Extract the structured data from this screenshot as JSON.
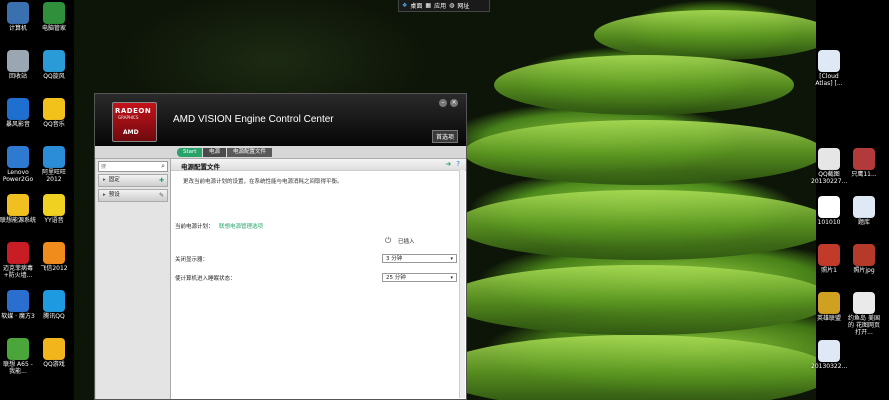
{
  "taskbar": {
    "items": [
      "桌面",
      "应用",
      "网址"
    ]
  },
  "desktop_left": [
    {
      "label": "计算机",
      "icon": "computer-icon",
      "color": "#3a6fb0"
    },
    {
      "label": "电脑管家",
      "icon": "shield-icon",
      "color": "#2f8f3a"
    },
    {
      "label": "回收站",
      "icon": "recycle-bin-icon",
      "color": "#9aa7b3"
    },
    {
      "label": "QQ旋风",
      "icon": "qq-whirlwind-icon",
      "color": "#2a9bd6"
    },
    {
      "label": "暴风影音",
      "icon": "storm-player-icon",
      "color": "#1f6fd1"
    },
    {
      "label": "QQ音乐",
      "icon": "qq-music-icon",
      "color": "#f2c21b"
    },
    {
      "label": "Lenovo Power2Go",
      "icon": "power2go-icon",
      "color": "#2f7ad1"
    },
    {
      "label": "阿里旺旺 2012",
      "icon": "aliwangwang-icon",
      "color": "#2b8cd8"
    },
    {
      "label": "联想能源系统",
      "icon": "lenovo-energy-icon",
      "color": "#f0c020"
    },
    {
      "label": "YY语音",
      "icon": "yy-voice-icon",
      "color": "#f0d020"
    },
    {
      "label": "迈克菲病毒 +防火墙...",
      "icon": "mcafee-icon",
      "color": "#c81d25"
    },
    {
      "label": "飞信2012",
      "icon": "fetion-icon",
      "color": "#f08c1c"
    },
    {
      "label": "软媒 · 魔方3",
      "icon": "rubik-cube-icon",
      "color": "#2a6fd0"
    },
    {
      "label": "腾讯QQ",
      "icon": "tencent-qq-icon",
      "color": "#1e9be0"
    },
    {
      "label": "联想 A65 - 我能...",
      "icon": "lenovo-phone-icon",
      "color": "#4aa63a"
    },
    {
      "label": "QQ游戏",
      "icon": "qq-game-icon",
      "color": "#f2b51c"
    }
  ],
  "desktop_right": [
    {
      "label": "[Cloud Atlas] [...",
      "icon": "document-icon",
      "color": "#dfe8f5"
    },
    {
      "label": "QQ截图 20130227...",
      "icon": "image-file-icon",
      "color": "#e6e6e6"
    },
    {
      "label": "只鹰11...",
      "icon": "person-photo-icon",
      "color": "#b33a3a"
    },
    {
      "label": "101010",
      "icon": "text-file-icon",
      "color": "#ffffff"
    },
    {
      "label": "题库",
      "icon": "folder-file-icon",
      "color": "#dfe8f5"
    },
    {
      "label": "照片1",
      "icon": "photo1-icon",
      "color": "#c23a2a"
    },
    {
      "label": "照片jpg",
      "icon": "photo-jpg-icon",
      "color": "#b53a2a"
    },
    {
      "label": "英雄联盟",
      "icon": "lol-icon",
      "color": "#d0a020"
    },
    {
      "label": "约鱼岛 美国的 花图网页打开...",
      "icon": "web-image-icon",
      "color": "#eaeaea"
    },
    {
      "label": "20130322...",
      "icon": "doc2013-icon",
      "color": "#dfe8f5"
    }
  ],
  "window": {
    "logo_line1": "RADEON",
    "logo_line2": "GRAPHICS",
    "logo_line3": "AMD",
    "title": "AMD VISION Engine Control Center",
    "preferences_label": "首选项",
    "breadcrumb": [
      "Start",
      "电源",
      "电源配置文件"
    ],
    "search_placeholder": "搜",
    "sidebar_items": [
      {
        "label": "固定"
      },
      {
        "label": "预设"
      }
    ],
    "content_title": "电源配置文件",
    "description": "更改当前电源计划的设置，在系统性能与电源消耗之间取得平衡。",
    "current_plan_label": "当前电源计划：",
    "current_plan_value": "联想电源管理选项",
    "plugged_in_label": "已插入",
    "display_off_label": "关闭显示器：",
    "display_off_value": "3 分钟",
    "sleep_label": "使计算机进入睡眠状态：",
    "sleep_value": "25 分钟"
  }
}
